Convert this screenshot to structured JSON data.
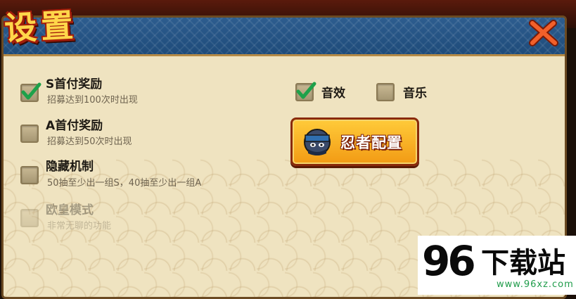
{
  "dialog": {
    "title": "设置",
    "colors": {
      "header": "#1e4b7a",
      "panel": "#efe3c0",
      "title_text": "#ffd64a",
      "check": "#1ea14a"
    }
  },
  "options": [
    {
      "label": "S首付奖励",
      "desc": "招募达到100次时出现",
      "checked": true,
      "enabled": true
    },
    {
      "label": "A首付奖励",
      "desc": "招募达到50次时出现",
      "checked": false,
      "enabled": true
    },
    {
      "label": "隐藏机制",
      "desc": "50抽至少出一组S，40抽至少出一组A",
      "checked": false,
      "enabled": true
    },
    {
      "label": "欧皇模式",
      "desc": "非常无聊的功能",
      "checked": false,
      "enabled": false
    }
  ],
  "audio": [
    {
      "label": "音效",
      "checked": true
    },
    {
      "label": "音乐",
      "checked": false
    }
  ],
  "ninja_button": {
    "label": "忍者配置",
    "icon": "ninja-avatar-icon"
  },
  "close_icon": "close-x-icon",
  "watermark": {
    "number": "96",
    "name": "下载站",
    "url": "www.96xz.com"
  }
}
